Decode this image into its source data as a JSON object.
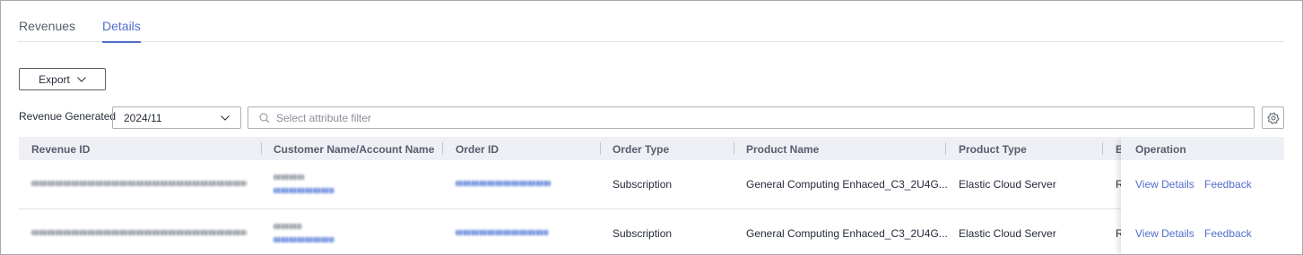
{
  "tabs": [
    {
      "label": "Revenues",
      "active": false
    },
    {
      "label": "Details",
      "active": true
    }
  ],
  "toolbar": {
    "export_label": "Export"
  },
  "filters": {
    "revenue_label": "Revenue Generated",
    "month_value": "2024/11",
    "search_placeholder": "Select attribute filter"
  },
  "table": {
    "headers": {
      "revenue_id": "Revenue ID",
      "customer": "Customer Name/Account Name",
      "order_id": "Order ID",
      "order_type": "Order Type",
      "product_name": "Product Name",
      "product_type": "Product Type",
      "b_col": "B",
      "operation": "Operation"
    },
    "rows": [
      {
        "order_type": "Subscription",
        "product_name": "General Computing Enhaced_C3_2U4G...",
        "product_type": "Elastic Cloud Server",
        "b_col": "R",
        "view_label": "View Details",
        "feedback_label": "Feedback"
      },
      {
        "order_type": "Subscription",
        "product_name": "General Computing Enhaced_C3_2U4G...",
        "product_type": "Elastic Cloud Server",
        "b_col": "R",
        "view_label": "View Details",
        "feedback_label": "Feedback"
      }
    ]
  },
  "colors": {
    "accent": "#526ecc",
    "header_bg": "#eef0f5",
    "text": "#252b3a"
  }
}
